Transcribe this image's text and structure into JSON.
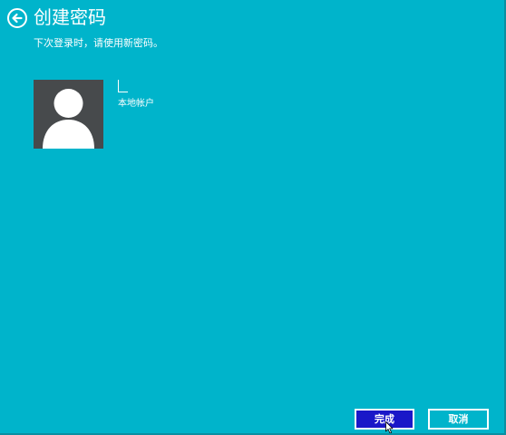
{
  "header": {
    "title": "创建密码",
    "subtitle": "下次登录时，请使用新密码。",
    "back_icon": "back-arrow-icon"
  },
  "account": {
    "username": "",
    "type_label": "本地帐户",
    "avatar_icon": "user-silhouette-icon"
  },
  "buttons": {
    "finish_label": "完成",
    "cancel_label": "取消"
  },
  "colors": {
    "background": "#00b4cb",
    "finish_button": "#1a18c8",
    "avatar_background": "#474a4c",
    "text": "#ffffff"
  }
}
